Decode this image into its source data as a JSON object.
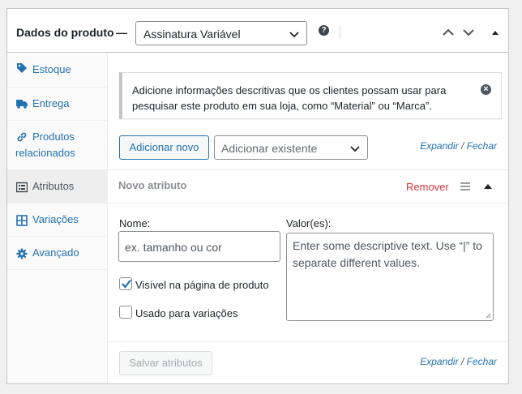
{
  "header": {
    "title": "Dados do produto",
    "dash": "—",
    "product_type": "Assinatura Variável",
    "help_icon": "?"
  },
  "sidebar": {
    "items": [
      {
        "label": "Estoque",
        "icon": "tag-icon"
      },
      {
        "label": "Entrega",
        "icon": "truck-icon"
      },
      {
        "label": "Produtos",
        "label2": "relacionados",
        "icon": "link-icon"
      },
      {
        "label": "Atributos",
        "icon": "list-icon",
        "active": true
      },
      {
        "label": "Variações",
        "icon": "grid-icon"
      },
      {
        "label": "Avançado",
        "icon": "gear-icon"
      }
    ]
  },
  "notice": {
    "text": "Adicione informações descritivas que os clientes possam usar para pesquisar este produto em sua loja, como “Material” ou “Marca”."
  },
  "toolbar": {
    "add_new_label": "Adicionar novo",
    "add_existing_placeholder": "Adicionar existente",
    "expand_label": "Expandir",
    "separator": "/",
    "close_label": "Fechar"
  },
  "attribute": {
    "title": "Novo atributo",
    "remove_label": "Remover",
    "name_label": "Nome:",
    "name_placeholder": "ex. tamanho ou cor",
    "values_label": "Valor(es):",
    "values_placeholder": "Enter some descriptive text. Use “|” to separate different values.",
    "visible_label": "Visível na página de produto",
    "visible_checked": true,
    "variations_label": "Usado para variações",
    "variations_checked": false
  },
  "footer": {
    "save_label": "Salvar atributos",
    "expand_label": "Expandir",
    "separator": "/",
    "close_label": "Fechar"
  },
  "colors": {
    "link": "#2271b1",
    "remove": "#d63638",
    "text": "#1d2327",
    "border": "#c3c4c7"
  }
}
